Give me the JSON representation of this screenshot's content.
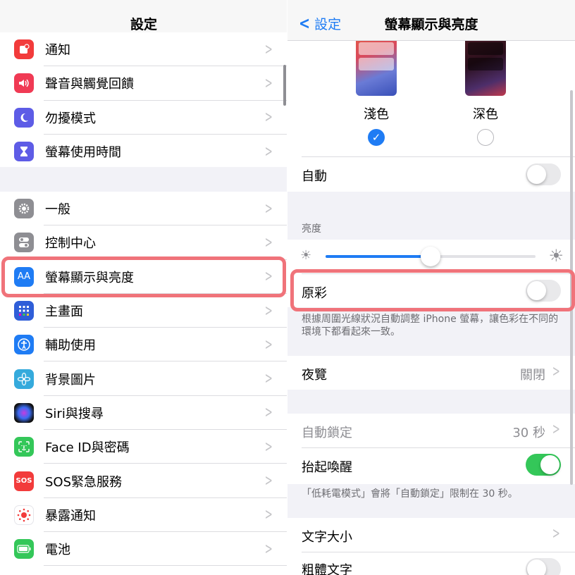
{
  "left": {
    "title": "設定",
    "group1": [
      {
        "label": "通知",
        "icon": "bell-icon",
        "color": "#f23b3b"
      },
      {
        "label": "聲音與觸覺回饋",
        "icon": "speaker-icon",
        "color": "#f03a54"
      },
      {
        "label": "勿擾模式",
        "icon": "moon-icon",
        "color": "#5d5ce6"
      },
      {
        "label": "螢幕使用時間",
        "icon": "hourglass-icon",
        "color": "#5e5ce6"
      }
    ],
    "group2": [
      {
        "label": "一般",
        "icon": "gear-icon",
        "color": "#8e8e93"
      },
      {
        "label": "控制中心",
        "icon": "toggles-icon",
        "color": "#8e8e93"
      },
      {
        "label": "螢幕顯示與亮度",
        "icon": "text-size-icon",
        "color": "#1f7cf4",
        "icon_text": "AA"
      },
      {
        "label": "主畫面",
        "icon": "grid-icon",
        "color": "#2f5ed8"
      },
      {
        "label": "輔助使用",
        "icon": "accessibility-icon",
        "color": "#1f7cf4"
      },
      {
        "label": "背景圖片",
        "icon": "flower-icon",
        "color": "#35aadc"
      },
      {
        "label": "Siri與搜尋",
        "icon": "siri-icon",
        "color": "#222"
      },
      {
        "label": "Face ID與密碼",
        "icon": "face-id-icon",
        "color": "#34c759"
      },
      {
        "label": "SOS緊急服務",
        "icon": "sos-icon",
        "color": "#f23b3b",
        "icon_text": "SOS"
      },
      {
        "label": "暴露通知",
        "icon": "exposure-icon",
        "color": "#fff"
      },
      {
        "label": "電池",
        "icon": "battery-icon",
        "color": "#34c759"
      }
    ]
  },
  "right": {
    "back_label": "設定",
    "title": "螢幕顯示與亮度",
    "appearance": {
      "light_label": "淺色",
      "dark_label": "深色"
    },
    "auto_label": "自動",
    "brightness_header": "亮度",
    "brightness_level": 0.5,
    "true_tone_label": "原彩",
    "true_tone_footnote": "根據周圍光線狀況自動調整 iPhone 螢幕，讓色彩在不同的環境下都看起來一致。",
    "night_shift_label": "夜覽",
    "night_shift_value": "關閉",
    "auto_lock_label": "自動鎖定",
    "auto_lock_value": "30 秒",
    "raise_to_wake_label": "抬起喚醒",
    "low_power_footnote": "「低耗電模式」會將「自動鎖定」限制在 30 秒。",
    "text_size_label": "文字大小",
    "bold_text_label": "粗體文字",
    "accent_color": "#1f7cf4",
    "highlight_color": "#f0737a"
  }
}
